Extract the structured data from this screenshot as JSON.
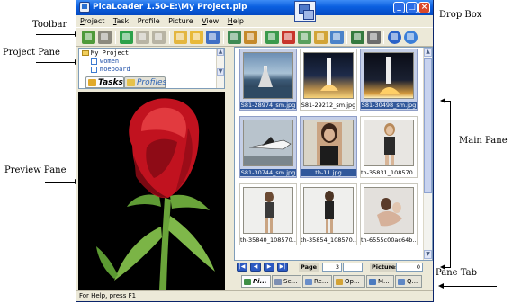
{
  "annotations": {
    "toolbar": "Toolbar",
    "project_pane": "Project Pane",
    "preview_pane": "Preview Pane",
    "drop_box": "Drop Box",
    "main_pane": "Main Pane",
    "pane_tab": "Pane Tab"
  },
  "window": {
    "title": "PicaLoader 1.50-E:\\My Project.plp",
    "buttons": {
      "minimize": "_",
      "maximize": "□",
      "close": "×"
    }
  },
  "menu": [
    {
      "ul": "P",
      "rest": "roject"
    },
    {
      "ul": "T",
      "rest": "ask"
    },
    {
      "ul": "",
      "rest": "Profile"
    },
    {
      "ul": "",
      "rest": "Picture"
    },
    {
      "ul": "V",
      "rest": "iew"
    },
    {
      "ul": "H",
      "rest": "elp"
    }
  ],
  "project": {
    "root": "My Project",
    "children": [
      "women",
      "moeboard"
    ]
  },
  "project_tabs": {
    "tasks": "Tasks",
    "profiles": "Profiles"
  },
  "thumbnails": [
    {
      "label": "S81-28974_sm.jpg",
      "selected": true
    },
    {
      "label": "S81-29212_sm.jpg",
      "selected": false
    },
    {
      "label": "S81-30498_sm.jpg",
      "selected": true
    },
    {
      "label": "S81-30744_sm.jpg",
      "selected": true
    },
    {
      "label": "th-11.jpg",
      "selected": true
    },
    {
      "label": "th-35831_108570...",
      "selected": false
    },
    {
      "label": "th-35840_108570...",
      "selected": false
    },
    {
      "label": "th-35854_108570...",
      "selected": false
    },
    {
      "label": "th-6555c00ac64b...",
      "selected": false
    }
  ],
  "pager": {
    "page_label": "Page",
    "page_value": "3",
    "pictures_label": "Pictures",
    "pictures_value": "0",
    "buttons": [
      "|◀",
      "◀",
      "▶",
      "▶|"
    ]
  },
  "bottom_tabs": [
    "Pi...",
    "Se...",
    "Re...",
    "Op...",
    "M...",
    "Q..."
  ],
  "status": "For Help, press F1",
  "colors": {
    "titlebar": "#0a5fe0",
    "selected_label": "#31589b",
    "window_bg": "#ece9d8"
  }
}
